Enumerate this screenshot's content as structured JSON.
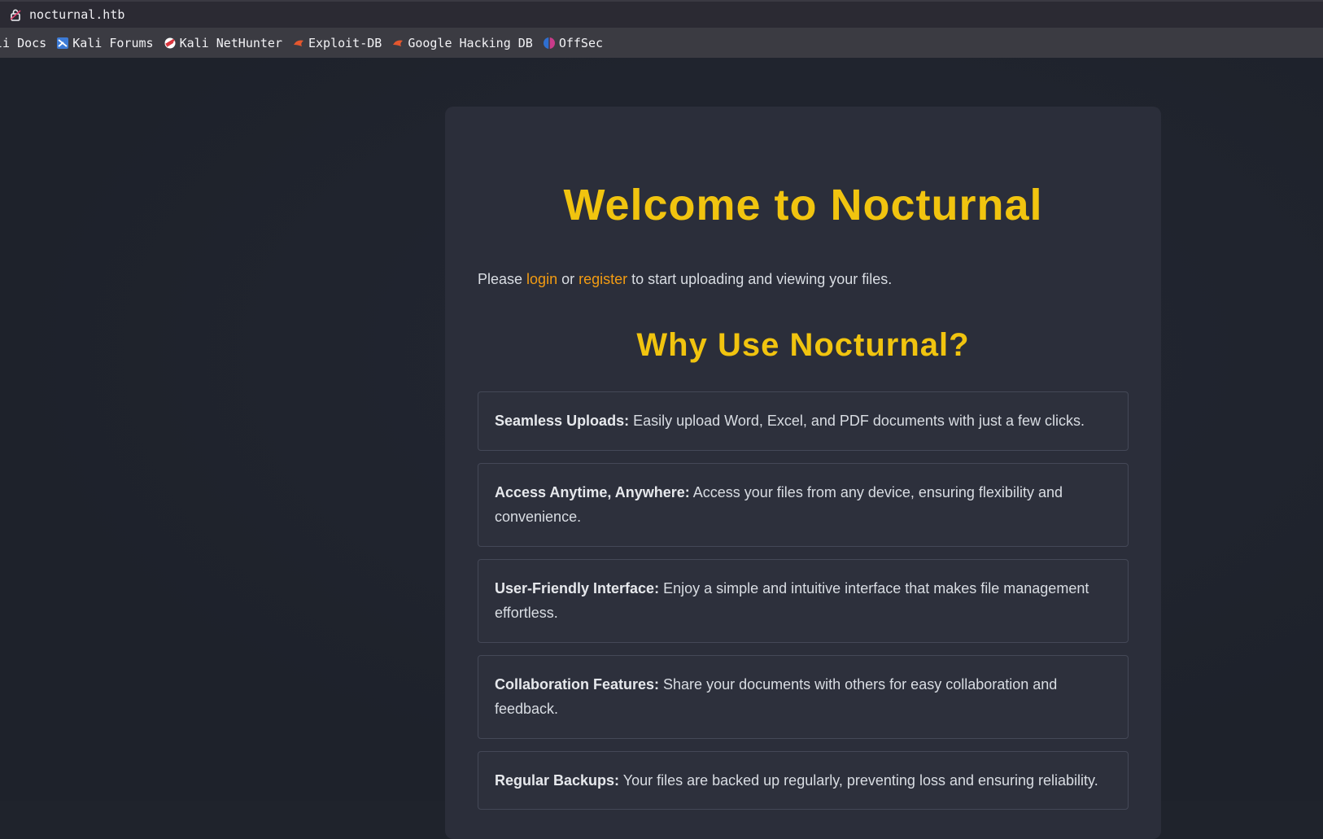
{
  "browser": {
    "url": "nocturnal.htb",
    "bookmarks": [
      {
        "label": "li Docs",
        "icon": "kali-docs-icon"
      },
      {
        "label": "Kali Forums",
        "icon": "kali-forums-icon"
      },
      {
        "label": "Kali NetHunter",
        "icon": "kali-nethunter-icon"
      },
      {
        "label": "Exploit-DB",
        "icon": "exploit-db-icon"
      },
      {
        "label": "Google Hacking DB",
        "icon": "google-hacking-db-icon"
      },
      {
        "label": "OffSec",
        "icon": "offsec-icon"
      }
    ]
  },
  "main": {
    "title": "Welcome to Nocturnal",
    "intro": {
      "before": "Please ",
      "login": "login",
      "middle": " or ",
      "register": "register",
      "after": " to start uploading and viewing your files."
    },
    "subtitle": "Why Use Nocturnal?",
    "features": [
      {
        "heading": "Seamless Uploads:",
        "text": " Easily upload Word, Excel, and PDF documents with just a few clicks."
      },
      {
        "heading": "Access Anytime, Anywhere:",
        "text": " Access your files from any device, ensuring flexibility and convenience."
      },
      {
        "heading": "User-Friendly Interface:",
        "text": " Enjoy a simple and intuitive interface that makes file management effortless."
      },
      {
        "heading": "Collaboration Features:",
        "text": " Share your documents with others for easy collaboration and feedback."
      },
      {
        "heading": "Regular Backups:",
        "text": " Your files are backed up regularly, preventing loss and ensuring reliability."
      }
    ]
  },
  "colors": {
    "accent_title": "#f1c40f",
    "link": "#f39c12",
    "background": "#1f232c",
    "card": "#2b2e3a"
  }
}
